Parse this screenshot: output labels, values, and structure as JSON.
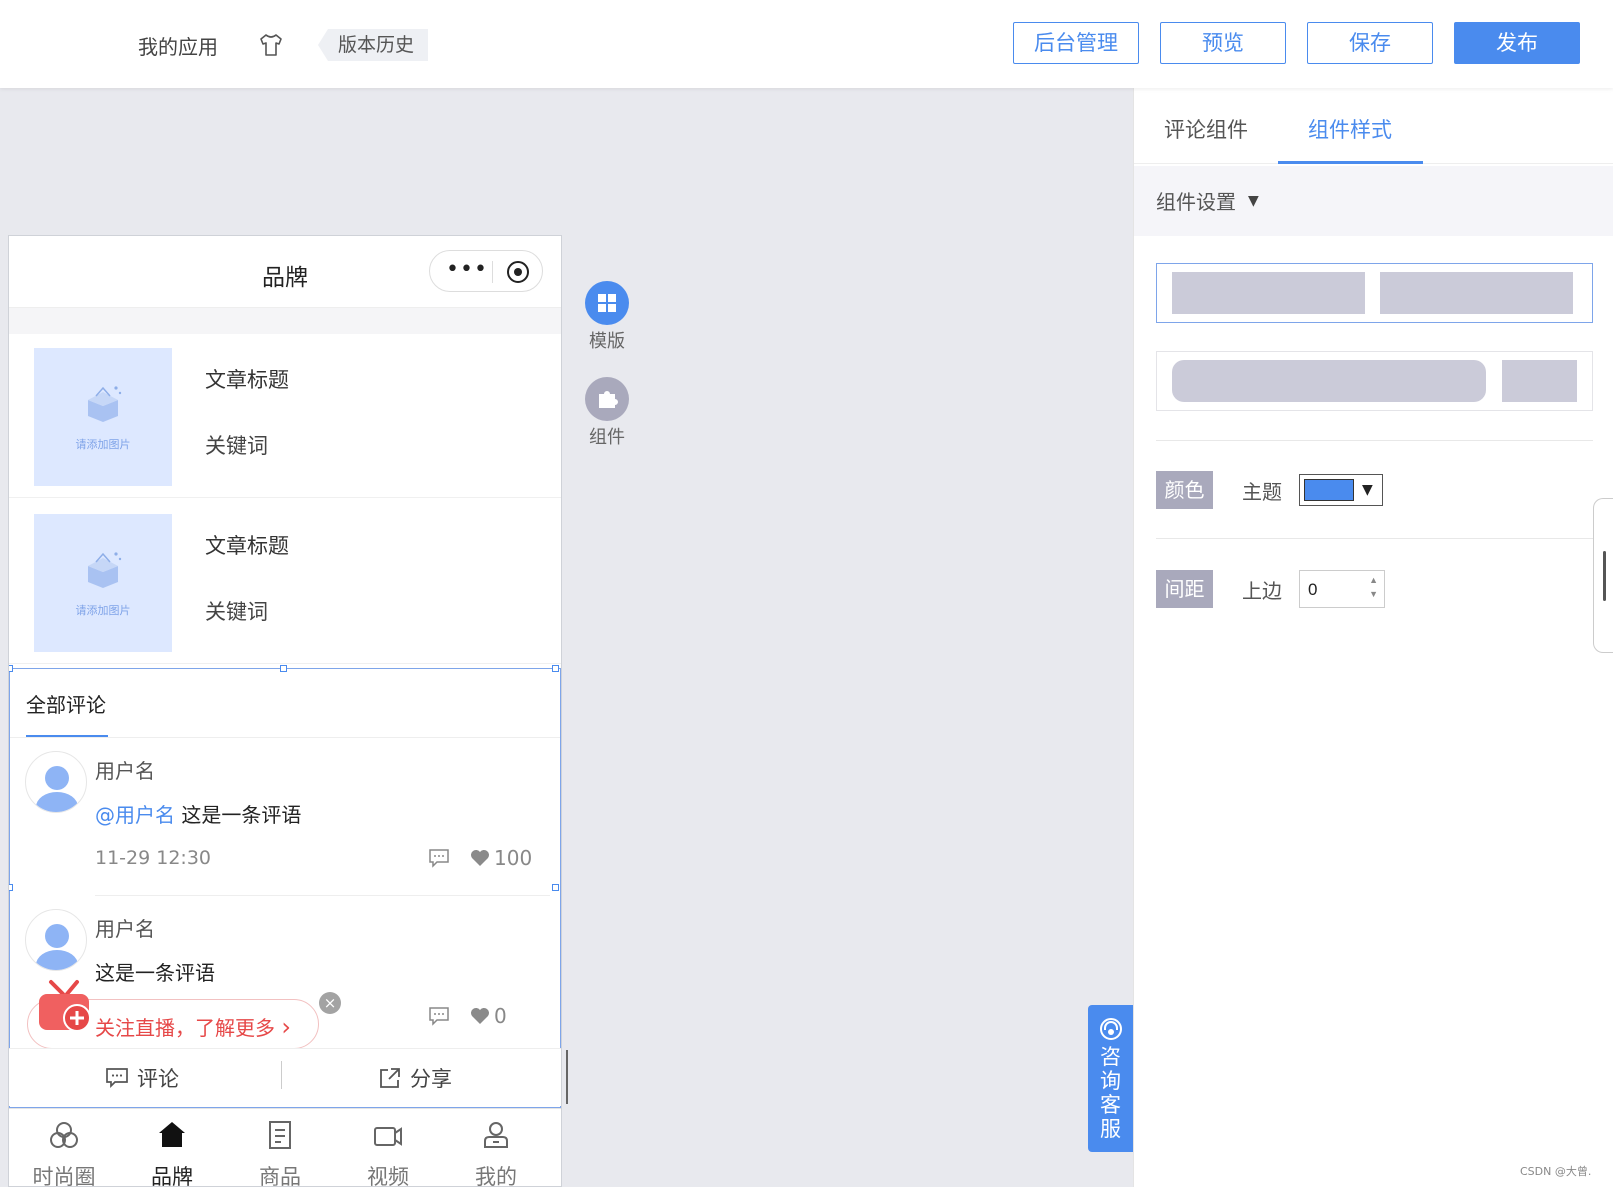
{
  "topbar": {
    "app_title": "我的应用",
    "history_label": "版本历史",
    "buttons": {
      "admin": "后台管理",
      "preview": "预览",
      "save": "保存",
      "publish": "发布"
    }
  },
  "phone": {
    "title": "品牌",
    "capsule_dots": "•••",
    "articles": [
      {
        "image_caption": "请添加图片",
        "title": "文章标题",
        "keyword": "关键词"
      },
      {
        "image_caption": "请添加图片",
        "title": "文章标题",
        "keyword": "关键词"
      }
    ],
    "comments_section": {
      "title": "全部评论",
      "comments": [
        {
          "user": "用户名",
          "mention": "@用户名",
          "text": " 这是一条评语",
          "time": "11-29 12:30",
          "likes": "100"
        },
        {
          "user": "用户名",
          "mention": "",
          "text": "这是一条评语",
          "time": "",
          "likes": "0"
        }
      ]
    },
    "live_banner": {
      "text": "关注直播，了解更多",
      "chevron": "›",
      "close": "×"
    },
    "action_bar": {
      "comment": "评论",
      "share": "分享"
    },
    "tabbar": [
      {
        "label": "时尚圈",
        "icon": "circles-icon"
      },
      {
        "label": "品牌",
        "icon": "home-icon",
        "active": true
      },
      {
        "label": "商品",
        "icon": "document-icon"
      },
      {
        "label": "视频",
        "icon": "video-icon"
      },
      {
        "label": "我的",
        "icon": "user-icon"
      }
    ]
  },
  "tools": {
    "template": "模版",
    "component": "组件"
  },
  "consult": {
    "text": "咨询客服"
  },
  "right_panel": {
    "tabs": [
      {
        "label": "评论组件"
      },
      {
        "label": "组件样式",
        "active": true
      }
    ],
    "section_title": "组件设置",
    "color_prop": {
      "tag": "颜色",
      "label": "主题",
      "value": "#4a8bee"
    },
    "spacing_prop": {
      "tag": "间距",
      "label": "上边",
      "value": "0"
    }
  },
  "colors": {
    "accent": "#4a8bee",
    "danger": "#e64848",
    "placeholder": "#cbcbd9"
  },
  "watermark": "CSDN @大曾."
}
